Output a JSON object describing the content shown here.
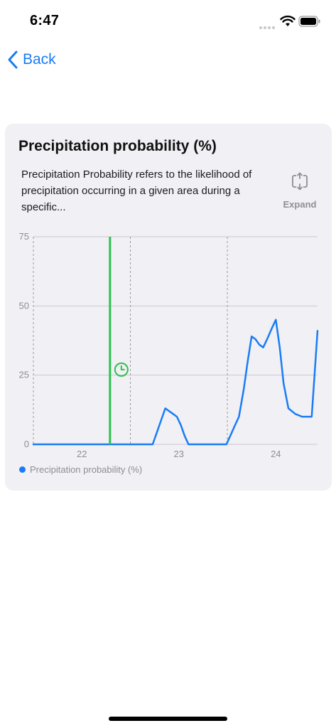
{
  "status_bar": {
    "time": "6:47"
  },
  "nav": {
    "back_label": "Back"
  },
  "card": {
    "title": "Precipitation probability (%)",
    "description": "Precipitation Probability refers to the likelihood of precipitation occurring in a given area during a specific...",
    "expand_label": "Expand"
  },
  "colors": {
    "accent": "#1a7cf5",
    "series": "#1a7cf5",
    "now_marker": "#2cc24a"
  },
  "chart_data": {
    "type": "line",
    "xlabel": "",
    "ylabel": "",
    "ylim": [
      0,
      75
    ],
    "xlim": [
      21.5,
      24.43
    ],
    "y_ticks": [
      0,
      25,
      50,
      75
    ],
    "x_ticks": [
      22,
      23,
      24
    ],
    "y_tick_labels": [
      "0",
      "25",
      "50",
      "75"
    ],
    "x_tick_labels": [
      "22",
      "23",
      "24"
    ],
    "grid": true,
    "day_boundaries": [
      21.5,
      22.5,
      23.5
    ],
    "now_marker_x": 22.29,
    "legend_position": "bottom-left",
    "series": [
      {
        "name": "Precipitation probability (%)",
        "x": [
          21.5,
          22.0,
          22.5,
          22.73,
          22.77,
          22.82,
          22.86,
          22.9,
          22.94,
          22.98,
          23.02,
          23.06,
          23.1,
          23.2,
          23.3,
          23.4,
          23.49,
          23.53,
          23.58,
          23.62,
          23.67,
          23.71,
          23.75,
          23.79,
          23.83,
          23.87,
          23.91,
          23.96,
          24.0,
          24.04,
          24.08,
          24.13,
          24.2,
          24.27,
          24.33,
          24.37,
          24.43
        ],
        "y": [
          0,
          0,
          0,
          0,
          4,
          9,
          13,
          12,
          11,
          10,
          7,
          3,
          0,
          0,
          0,
          0,
          0,
          3,
          7,
          10,
          20,
          30,
          39,
          38,
          36,
          35,
          38,
          42,
          45,
          35,
          22,
          13,
          11,
          10,
          10,
          10,
          41
        ]
      }
    ]
  }
}
